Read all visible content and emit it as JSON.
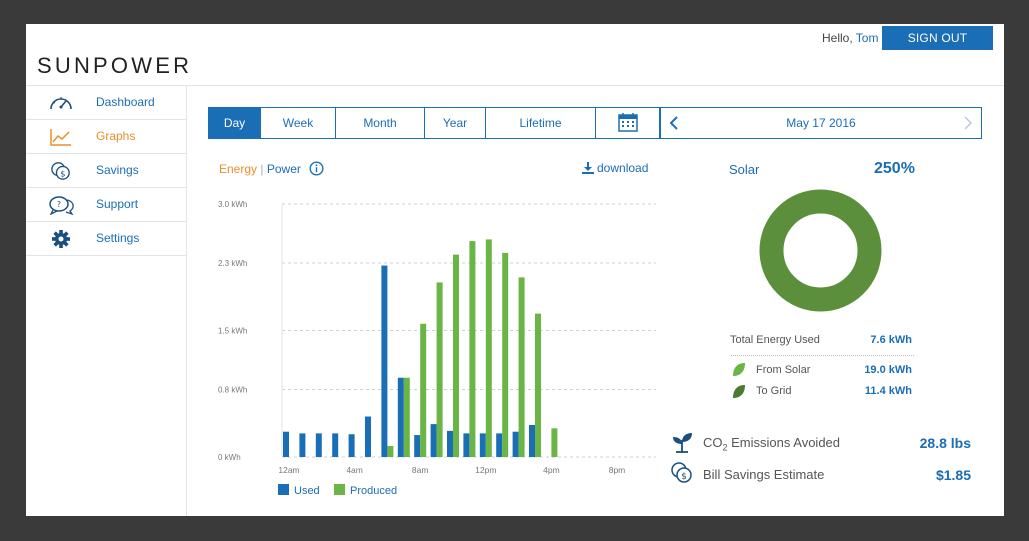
{
  "header": {
    "logo": "SUNPOWER",
    "greeting_prefix": "Hello, ",
    "user_name": "Tom",
    "sign_out_label": "SIGN OUT"
  },
  "sidebar": {
    "items": [
      {
        "label": "Dashboard",
        "icon": "gauge-icon",
        "active": false
      },
      {
        "label": "Graphs",
        "icon": "line-chart-icon",
        "active": true
      },
      {
        "label": "Savings",
        "icon": "coins-icon",
        "active": false
      },
      {
        "label": "Support",
        "icon": "chat-bubbles-icon",
        "active": false
      },
      {
        "label": "Settings",
        "icon": "gear-icon",
        "active": false
      }
    ]
  },
  "tabs": [
    {
      "label": "Day",
      "active": true
    },
    {
      "label": "Week",
      "active": false
    },
    {
      "label": "Month",
      "active": false
    },
    {
      "label": "Year",
      "active": false
    },
    {
      "label": "Lifetime",
      "active": false
    },
    {
      "label": "",
      "icon": "calendar-icon",
      "active": false
    }
  ],
  "date_nav": {
    "date": "May 17 2016"
  },
  "chart_header": {
    "energy_label": "Energy",
    "separator": "|",
    "power_label": "Power",
    "download_label": "download"
  },
  "chart_data": {
    "type": "bar",
    "y_ticks": [
      "3.0 kWh",
      "2.3 kWh",
      "1.5 kWh",
      "0.8 kWh",
      "0 kWh"
    ],
    "y_tick_values": [
      3.0,
      2.3,
      1.5,
      0.8,
      0
    ],
    "x_tick_labels": [
      "12am",
      "4am",
      "8am",
      "12pm",
      "4pm",
      "8pm"
    ],
    "ylim": [
      0,
      3.0
    ],
    "grid": true,
    "legend_position": "bottom-left",
    "hours": [
      0,
      1,
      2,
      3,
      4,
      5,
      6,
      7,
      8,
      9,
      10,
      11,
      12,
      13,
      14,
      15,
      16,
      17,
      18,
      19,
      20,
      21,
      22,
      23
    ],
    "series": [
      {
        "name": "Used",
        "color": "#1a6eb5",
        "values": [
          0.3,
          0.28,
          0.28,
          0.28,
          0.27,
          0.48,
          2.27,
          0.94,
          0.26,
          0.39,
          0.31,
          0.28,
          0.28,
          0.28,
          0.3,
          0.38,
          0,
          0,
          0,
          0,
          0,
          0,
          0,
          0
        ]
      },
      {
        "name": "Produced",
        "color": "#6ab545",
        "values": [
          0,
          0,
          0,
          0,
          0,
          0,
          0.13,
          0.94,
          1.58,
          2.07,
          2.4,
          2.56,
          2.58,
          2.42,
          2.13,
          1.7,
          0.34,
          0,
          0,
          0,
          0,
          0,
          0,
          0
        ]
      }
    ]
  },
  "solar": {
    "label": "Solar",
    "percent": "250%",
    "donut_color": "#5b8f3b",
    "total_label": "Total Energy Used",
    "total_value": "7.6 kWh",
    "from_solar_label": "From Solar",
    "from_solar_value": "19.0 kWh",
    "to_grid_label": "To Grid",
    "to_grid_value": "11.4 kWh"
  },
  "summary": {
    "co2_label_pre": "CO",
    "co2_label_sub": "2",
    "co2_label_post": " Emissions Avoided",
    "co2_value": "28.8 lbs",
    "savings_label": "Bill Savings Estimate",
    "savings_value": "$1.85"
  }
}
